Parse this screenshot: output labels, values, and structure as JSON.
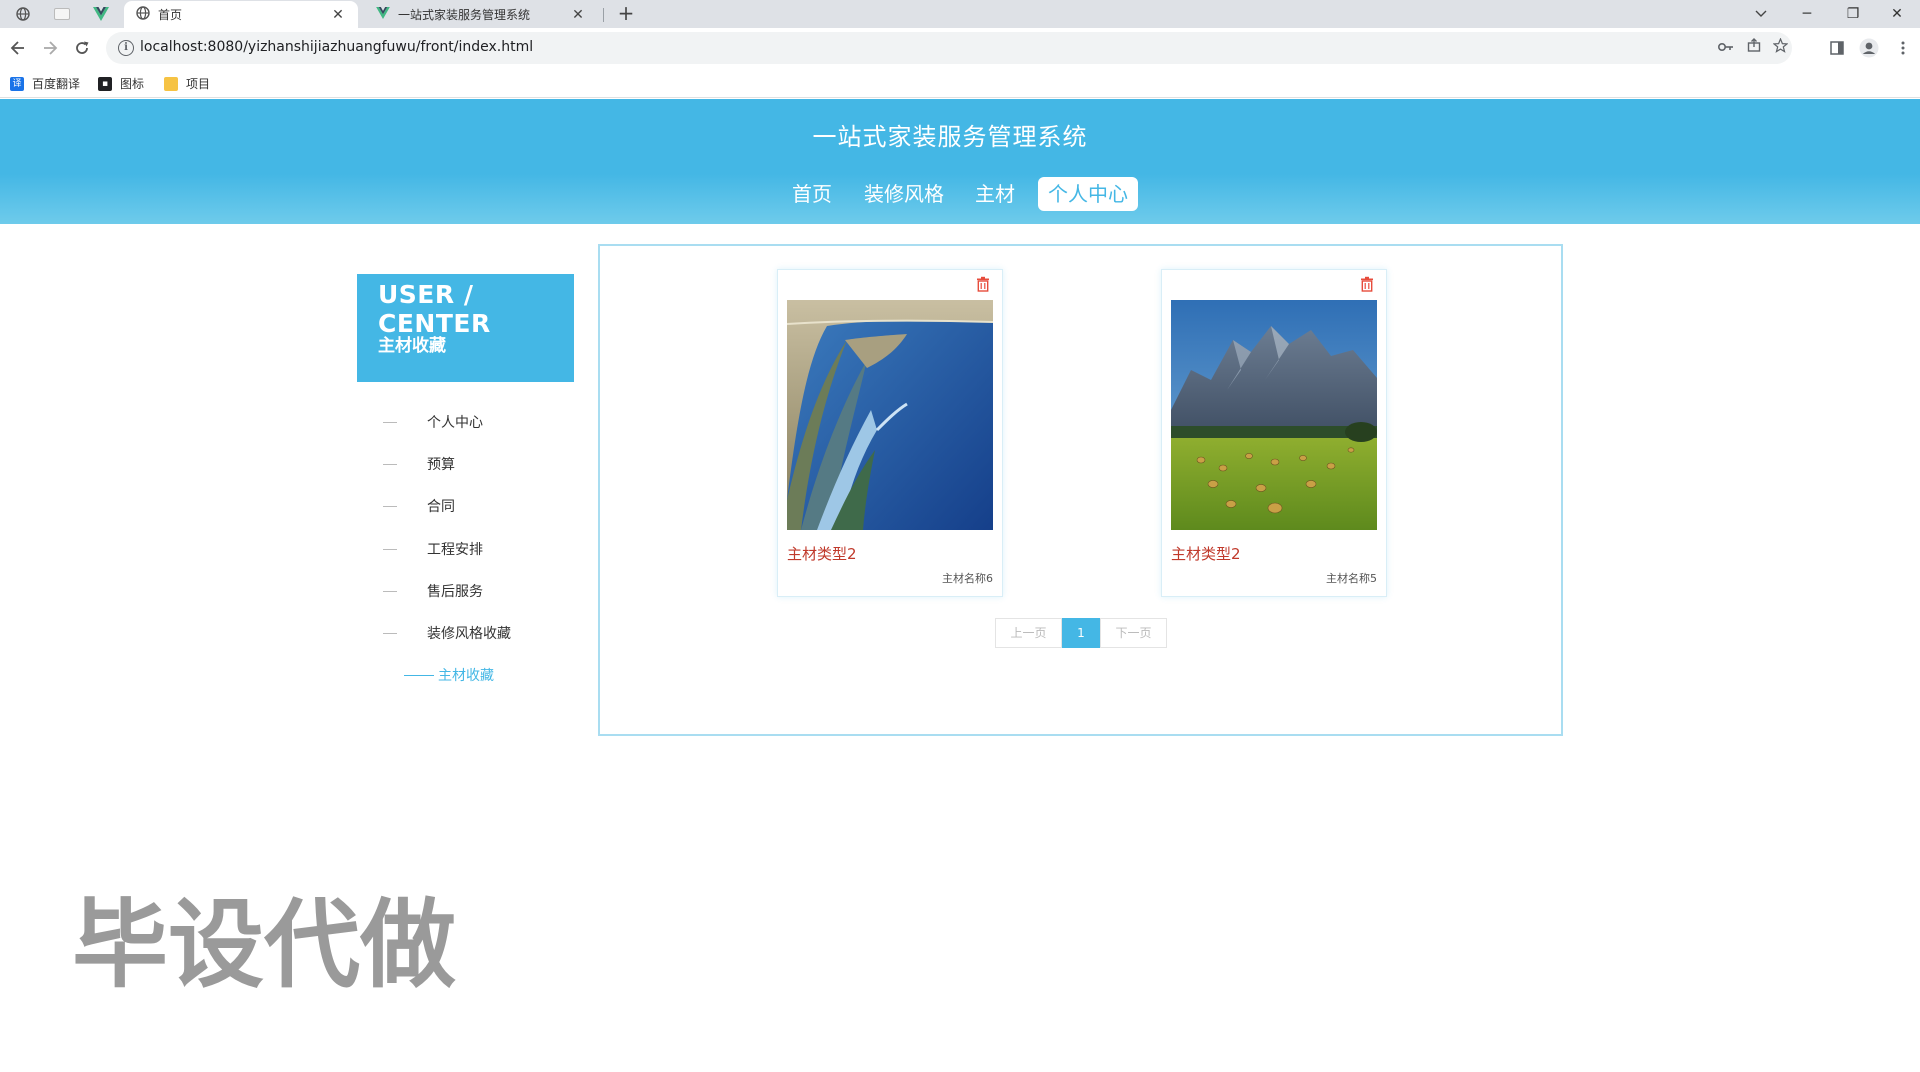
{
  "browser": {
    "tabs": [
      {
        "title": "首页",
        "icon": "globe-icon",
        "active": true
      },
      {
        "title": "一站式家装服务管理系统",
        "icon": "vue-logo-icon",
        "active": false
      }
    ],
    "close_glyph": "✕",
    "new_tab_glyph": "+",
    "window_controls": {
      "minimize": "─",
      "restore": "❐",
      "close": "✕"
    },
    "url": "localhost:8080/yizhanshijiazhuangfuwu/front/index.html",
    "bookmarks": [
      {
        "label": "百度翻译",
        "icon": "translate-icon",
        "color": "#1a73e8"
      },
      {
        "label": "图标",
        "icon": "image-icon",
        "color": "#202124"
      },
      {
        "label": "项目",
        "icon": "folder-icon",
        "color": "#f6c344"
      }
    ]
  },
  "site": {
    "title": "一站式家装服务管理系统",
    "nav": [
      {
        "label": "首页",
        "active": false
      },
      {
        "label": "装修风格",
        "active": false
      },
      {
        "label": "主材",
        "active": false
      },
      {
        "label": "个人中心",
        "active": true
      }
    ]
  },
  "user_center": {
    "heading_en": "USER / CENTER",
    "heading_zh": "主材收藏",
    "menu": [
      {
        "label": "个人中心",
        "active": false
      },
      {
        "label": "预算",
        "active": false
      },
      {
        "label": "合同",
        "active": false
      },
      {
        "label": "工程安排",
        "active": false
      },
      {
        "label": "售后服务",
        "active": false
      },
      {
        "label": "装修风格收藏",
        "active": false
      },
      {
        "label": "主材收藏",
        "active": true
      }
    ]
  },
  "favorites": [
    {
      "type": "主材类型2",
      "name": "主材名称6",
      "image": "coastline-aerial-photo"
    },
    {
      "type": "主材类型2",
      "name": "主材名称5",
      "image": "mountain-hay-field-photo"
    }
  ],
  "pagination": {
    "prev": "上一页",
    "page": "1",
    "next": "下一页"
  },
  "watermark": "毕设代做",
  "colors": {
    "accent": "#44b7e5",
    "type_text": "#c0392b",
    "delete_icon": "#e74c3c"
  }
}
